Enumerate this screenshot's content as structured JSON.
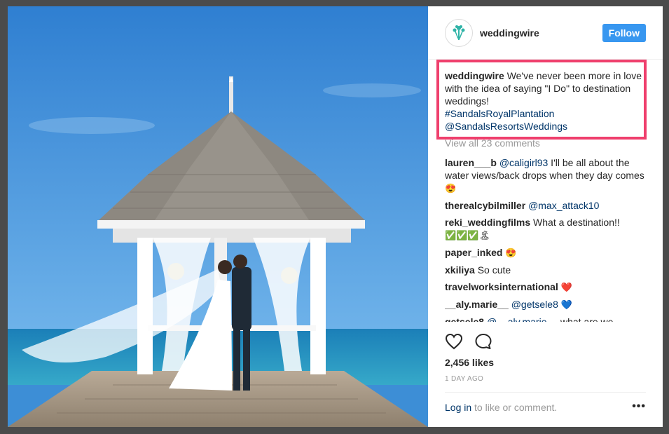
{
  "header": {
    "username": "weddingwire",
    "follow_label": "Follow"
  },
  "caption": {
    "username": "weddingwire",
    "text": "We've never been more in love with the idea of saying \"I Do\" to destination weddings!",
    "hashtag": "#SandalsRoyalPlantation",
    "mention": "@SandalsResortsWeddings"
  },
  "view_all": "View all 23 comments",
  "comments": [
    {
      "user": "lauren___b",
      "mention": "@caligirl93",
      "text": " I'll be all about the water views/back drops when they day comes ",
      "emoji": "😍"
    },
    {
      "user": "therealcybilmiller",
      "mention": "@max_attack10",
      "text": ""
    },
    {
      "user": "reki_weddingfilms",
      "text": "What a destination!!",
      "emoji": "✅✅✅🏝"
    },
    {
      "user": "paper_inked",
      "emoji": "😍"
    },
    {
      "user": "xkiliya",
      "text": "So cute"
    },
    {
      "user": "travelworksinternational",
      "emoji": "❤️"
    },
    {
      "user": "__aly.marie__",
      "mention": "@getsele8",
      "emoji": "💙"
    },
    {
      "user": "getsele8",
      "mention": "@__aly.marie__",
      "text": " what are we"
    }
  ],
  "likes": "2,456 likes",
  "time_ago": "1 DAY AGO",
  "footer": {
    "login": "Log in",
    "rest": " to like or comment.",
    "more": "•••"
  },
  "icons": {
    "like": "heart-icon",
    "comment": "comment-icon",
    "avatar": "bouquet-icon"
  },
  "colors": {
    "follow": "#3897f0",
    "highlight": "#ef3f6d",
    "link": "#003569"
  }
}
